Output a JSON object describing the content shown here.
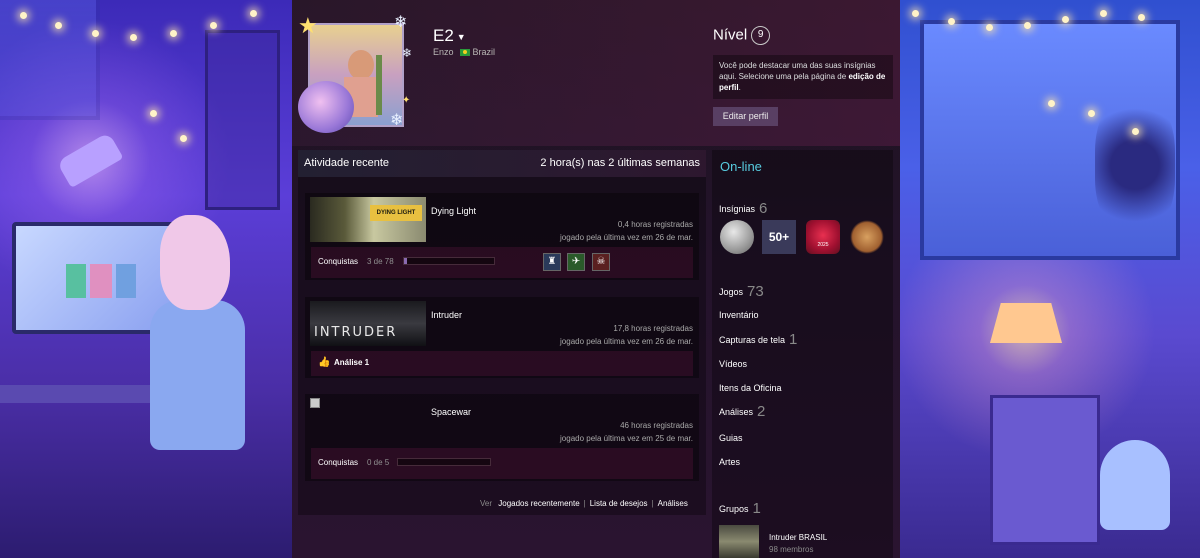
{
  "profile": {
    "persona_name": "E2",
    "real_name": "Enzo",
    "country": "Brazil",
    "level_label": "Nível",
    "level": "9",
    "badge_hint_pre": "Você pode destacar uma das suas insígnias aqui. Selecione uma pela página de ",
    "badge_hint_bold": "edição de perfil",
    "badge_hint_post": ".",
    "edit_button": "Editar perfil"
  },
  "activity": {
    "title": "Atividade recente",
    "hours": "2 hora(s) nas 2 últimas semanas",
    "games": [
      {
        "name": "Dying Light",
        "capsule_text": "DYING LIGHT",
        "hours": "0,4 horas registradas",
        "last_played": "jogado pela última vez em 26 de mar.",
        "footer": "achievements",
        "ach_label": "Conquistas",
        "ach_count": "3 de 78",
        "ach_progress": 0.038
      },
      {
        "name": "Intruder",
        "capsule_text": "INTRUDER",
        "hours": "17,8 horas registradas",
        "last_played": "jogado pela última vez em 26 de mar.",
        "footer": "review",
        "review_label": "Análise 1"
      },
      {
        "name": "Spacewar",
        "hours": "46 horas registradas",
        "last_played": "jogado pela última vez em 25 de mar.",
        "footer": "achievements",
        "ach_label": "Conquistas",
        "ach_count": "0 de 5",
        "ach_progress": 0
      }
    ],
    "links": {
      "view": "Ver",
      "recent": "Jogados recentemente",
      "wishlist": "Lista de desejos",
      "reviews": "Análises"
    }
  },
  "sidebar": {
    "status": "On-line",
    "badges_label": "Insígnias",
    "badges_count": "6",
    "badge_50": "50+",
    "badge_2025": "2025",
    "games_label": "Jogos",
    "games_count": "73",
    "inventory": "Inventário",
    "screenshots_label": "Capturas de tela",
    "screenshots_count": "1",
    "videos": "Vídeos",
    "workshop": "Itens da Oficina",
    "reviews_label": "Análises",
    "reviews_count": "2",
    "guides": "Guias",
    "artwork": "Artes",
    "groups_label": "Grupos",
    "groups_count": "1",
    "group_name": "Intruder BRASIL",
    "group_members": "98 membros"
  },
  "colors": {
    "online": "#57cbde",
    "accent_purple": "#8a6ab0"
  }
}
